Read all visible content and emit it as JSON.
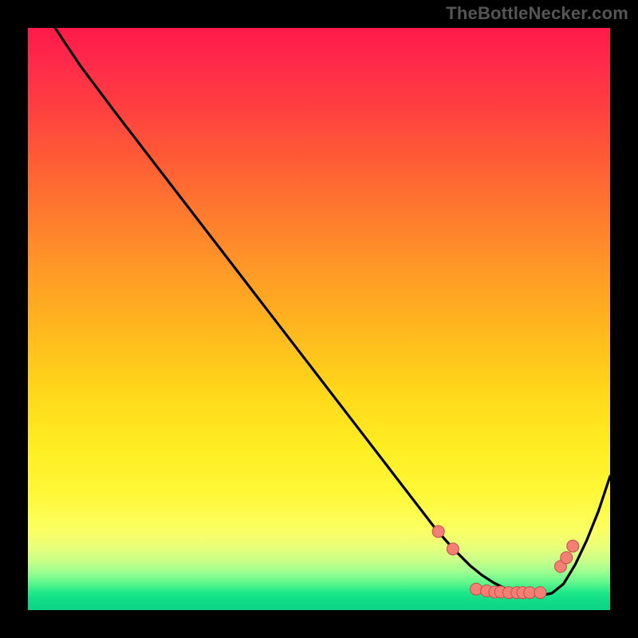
{
  "watermark": "TheBottleNecker.com",
  "colors": {
    "curve": "#000000",
    "marker_fill": "#f38074",
    "marker_stroke": "#c74b4b"
  },
  "chart_data": {
    "type": "line",
    "title": "",
    "xlabel": "",
    "ylabel": "",
    "xlim": [
      0,
      100
    ],
    "ylim": [
      0,
      100
    ],
    "curve_x": [
      4,
      6,
      9,
      12,
      15,
      20,
      25,
      30,
      35,
      40,
      45,
      50,
      55,
      60,
      65,
      70,
      73,
      76,
      78,
      80,
      82,
      84,
      86,
      88,
      90,
      92,
      94,
      96,
      98,
      100
    ],
    "curve_y": [
      101,
      98,
      93.5,
      89.5,
      85.5,
      79,
      72.5,
      66,
      59.5,
      53,
      46.5,
      40,
      33.5,
      27,
      20.5,
      14,
      10.6,
      7.6,
      6.0,
      4.7,
      3.7,
      3.0,
      2.6,
      2.5,
      2.9,
      4.5,
      7.8,
      12.0,
      17.0,
      23.0
    ],
    "markers": [
      {
        "x": 70.5,
        "y": 13.5
      },
      {
        "x": 73.0,
        "y": 10.5
      },
      {
        "x": 77.0,
        "y": 3.6
      },
      {
        "x": 78.8,
        "y": 3.3
      },
      {
        "x": 80.2,
        "y": 3.1
      },
      {
        "x": 81.2,
        "y": 3.1
      },
      {
        "x": 82.6,
        "y": 3.0
      },
      {
        "x": 84.0,
        "y": 3.0
      },
      {
        "x": 85.0,
        "y": 3.0
      },
      {
        "x": 86.2,
        "y": 3.0
      },
      {
        "x": 88.0,
        "y": 3.0
      },
      {
        "x": 91.5,
        "y": 7.5
      },
      {
        "x": 92.5,
        "y": 9.0
      },
      {
        "x": 93.6,
        "y": 11.0
      }
    ]
  }
}
